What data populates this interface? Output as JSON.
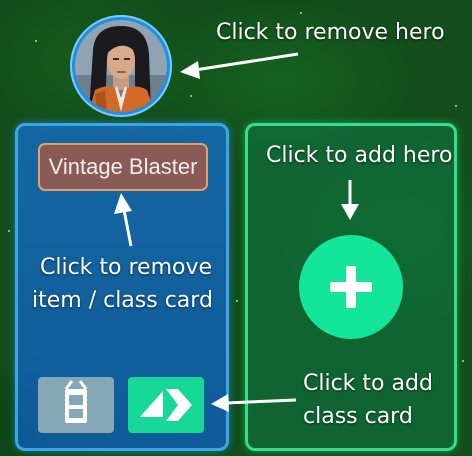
{
  "annotations": {
    "remove_hero": "Click to remove hero",
    "add_hero": "Click to add hero",
    "remove_item_line1": "Click to remove",
    "remove_item_line2": "item / class card",
    "add_class_line1": "Click to add",
    "add_class_line2": "class card"
  },
  "hero_panel": {
    "item_card_label": "Vintage Blaster",
    "equipment_icon": "equipment-icon",
    "swap_icon": "swap-arrows-icon"
  },
  "add_panel": {
    "add_icon": "plus-icon"
  },
  "colors": {
    "background": "#124d1b",
    "hero_panel": "#1f78c8",
    "hero_panel_border": "#3aa6e6",
    "add_panel_border": "#34de8e",
    "add_button": "#13e59a",
    "item_card": "#8a5a57",
    "item_card_border": "#e0a26a",
    "swap_button": "#16d897",
    "equipment_button": "#86a7b6"
  }
}
